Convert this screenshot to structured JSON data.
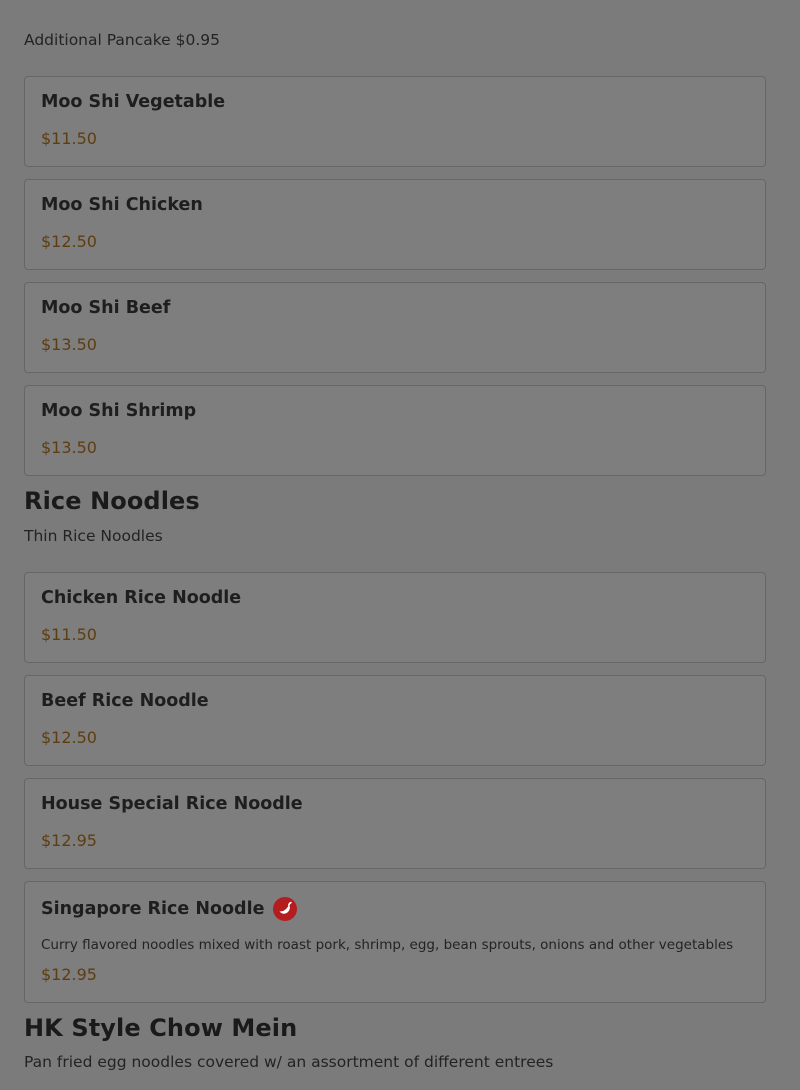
{
  "sections": [
    {
      "title": "",
      "note": "Additional Pancake $0.95",
      "items": [
        {
          "name": "Moo Shi Vegetable",
          "price": "$11.50"
        },
        {
          "name": "Moo Shi Chicken",
          "price": "$12.50"
        },
        {
          "name": "Moo Shi Beef",
          "price": "$13.50"
        },
        {
          "name": "Moo Shi Shrimp",
          "price": "$13.50"
        }
      ]
    },
    {
      "title": "Rice Noodles",
      "note": "Thin Rice Noodles",
      "items": [
        {
          "name": "Chicken Rice Noodle",
          "price": "$11.50"
        },
        {
          "name": "Beef Rice Noodle",
          "price": "$12.50"
        },
        {
          "name": "House Special Rice Noodle",
          "price": "$12.95"
        },
        {
          "name": "Singapore Rice Noodle",
          "icon": "spicy-chili-icon",
          "description": "Curry flavored noodles mixed with roast pork, shrimp, egg, bean sprouts, onions and other vegetables",
          "price": "$12.95"
        }
      ]
    },
    {
      "title": "HK Style Chow Mein",
      "note": "Pan fried egg noodles covered w/ an assortment of different entrees",
      "items": []
    }
  ],
  "colors": {
    "overlay_background": "#7b7b7b",
    "price_color": "#5e3d10",
    "spicy_icon_color": "#b41d20"
  }
}
